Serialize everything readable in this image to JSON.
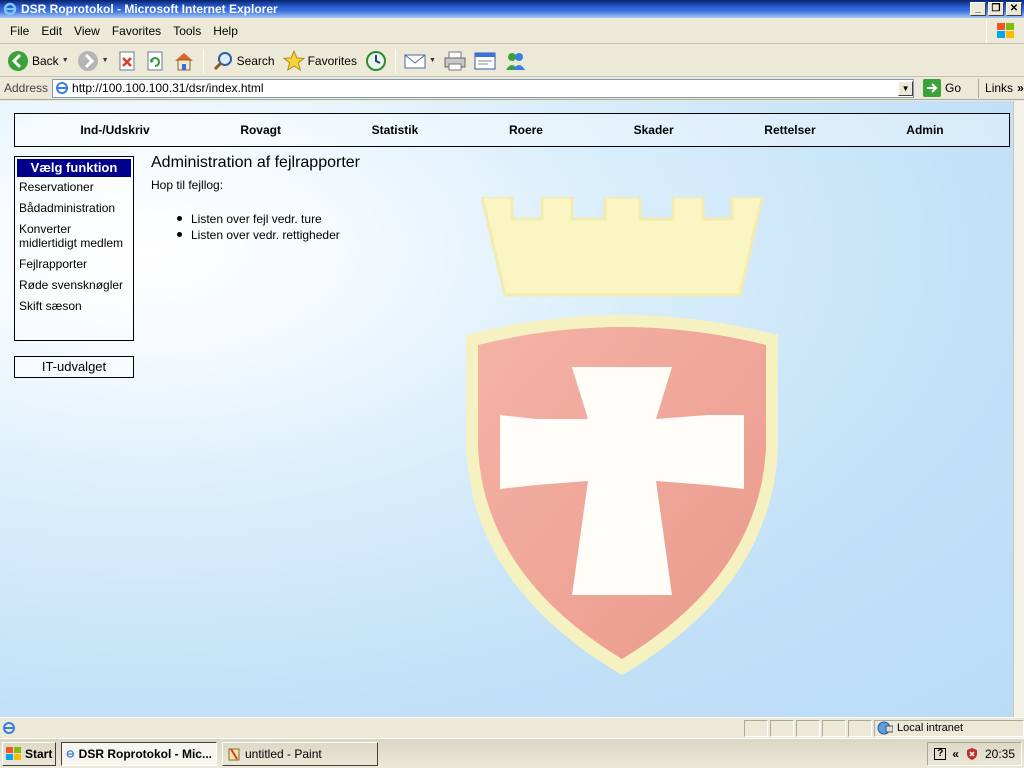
{
  "window": {
    "title": "DSR Roprotokol - Microsoft Internet Explorer",
    "controls": [
      "_",
      "❐",
      "✕"
    ]
  },
  "menubar": {
    "items": [
      "File",
      "Edit",
      "View",
      "Favorites",
      "Tools",
      "Help"
    ]
  },
  "toolbar": {
    "back": "Back",
    "search": "Search",
    "favorites": "Favorites"
  },
  "addressbar": {
    "label": "Address",
    "url": "http://100.100.100.31/dsr/index.html",
    "go": "Go",
    "links": "Links"
  },
  "page": {
    "topnav": [
      "Ind-/Udskriv",
      "Rovagt",
      "Statistik",
      "Roere",
      "Skader",
      "Rettelser",
      "Admin"
    ],
    "sidebar": {
      "header": "Vælg funktion",
      "items": [
        "Reservationer",
        "Bådadministration",
        "Konverter midlertidigt medlem",
        "Fejlrapporter",
        "Røde svensknøgler",
        "Skift sæson"
      ],
      "footer_box": "IT-udvalget"
    },
    "heading": "Administration af fejlrapporter",
    "intro": "Hop til fejllog:",
    "links": [
      "Listen over fejl vedr. ture",
      "Listen over vedr. rettigheder"
    ]
  },
  "statusbar": {
    "zone": "Local intranet"
  },
  "taskbar": {
    "start": "Start",
    "tasks": [
      "DSR Roprotokol - Mic...",
      "untitled - Paint"
    ],
    "clock": "20:35"
  },
  "colors": {
    "sidebar_header": "#00008b",
    "page_bg": "#c2e1f7",
    "crown": "#fbf5c4",
    "shield": "#efa495"
  }
}
